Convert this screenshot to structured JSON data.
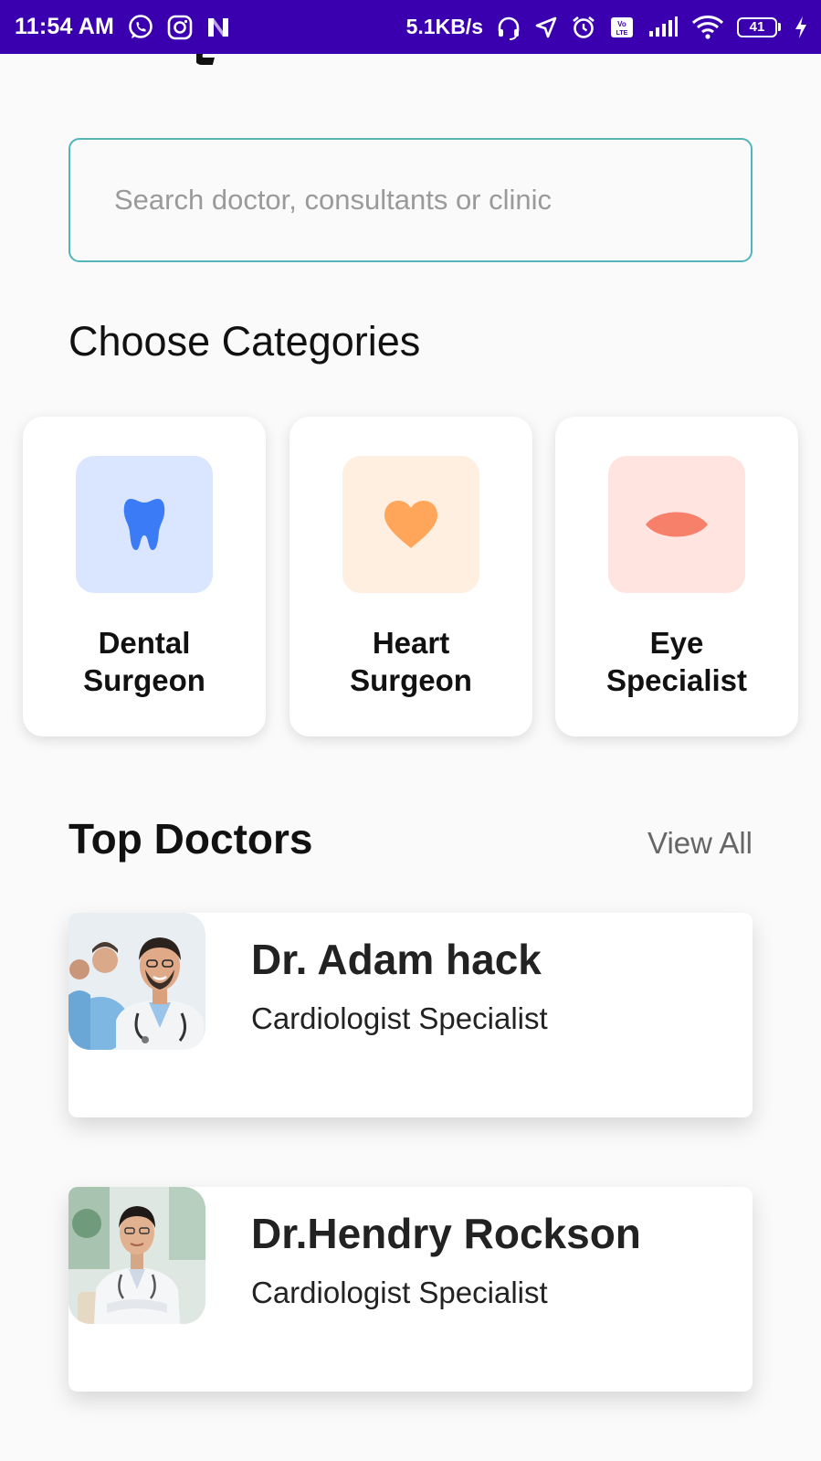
{
  "status_bar": {
    "time": "11:54 AM",
    "speed": "5.1KB/s",
    "battery": "41",
    "background_color": "#3a00b0",
    "left_icons": [
      "whatsapp-icon",
      "instagram-icon",
      "n-app-icon"
    ],
    "right_icons": [
      "headset-icon",
      "location-arrow-icon",
      "alarm-icon",
      "volte-icon",
      "signal-icon",
      "wifi-icon",
      "battery-icon",
      "charging-icon"
    ]
  },
  "search": {
    "placeholder": "Search doctor, consultants or clinic",
    "value": "",
    "border_color": "#52b5b9"
  },
  "categories": {
    "title": "Choose Categories",
    "items": [
      {
        "line1": "Dental",
        "line2": "Surgeon",
        "icon": "tooth-icon",
        "icon_color": "#3b7cf6",
        "bg_color": "#dae6ff"
      },
      {
        "line1": "Heart",
        "line2": "Surgeon",
        "icon": "heart-icon",
        "icon_color": "#ffa65a",
        "bg_color": "#ffefe0"
      },
      {
        "line1": "Eye",
        "line2": "Specialist",
        "icon": "eye-icon",
        "icon_color": "#f7806b",
        "bg_color": "#ffe4e0"
      }
    ]
  },
  "top_doctors": {
    "title": "Top Doctors",
    "view_all": "View All",
    "doctors": [
      {
        "name": "Dr. Adam hack",
        "specialty": "Cardiologist Specialist",
        "photo": "doctor-photo"
      },
      {
        "name": "Dr.Hendry Rockson",
        "specialty": "Cardiologist Specialist",
        "photo": "doctor-photo"
      }
    ]
  }
}
